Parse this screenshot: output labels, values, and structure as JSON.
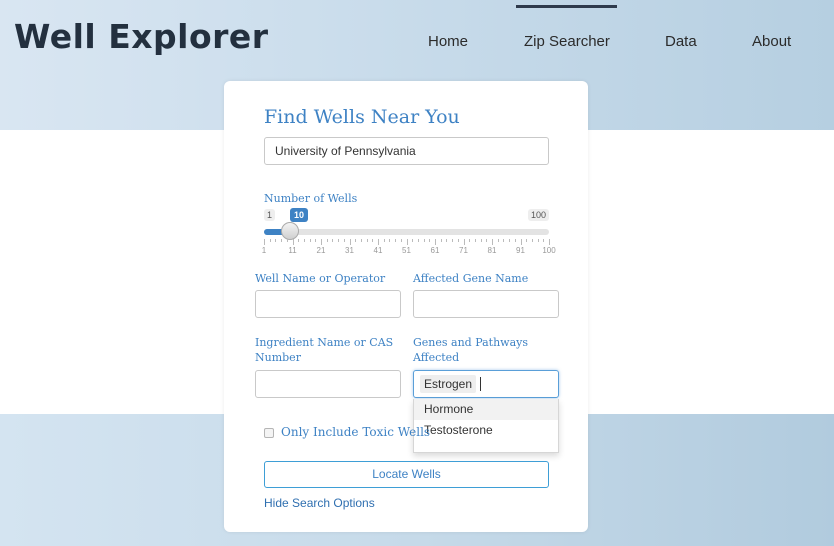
{
  "brand": "Well Explorer",
  "nav": {
    "home": "Home",
    "zip": "Zip Searcher",
    "data": "Data",
    "about": "About",
    "active": "Zip Searcher"
  },
  "form": {
    "title": "Find Wells Near You",
    "location_value": "University of Pennsylvania",
    "slider": {
      "label": "Number of Wells",
      "min": "1",
      "max": "100",
      "value": "10",
      "fraction": 0.09,
      "ticks": [
        "1",
        "11",
        "21",
        "31",
        "41",
        "51",
        "61",
        "71",
        "81",
        "91",
        "100"
      ]
    },
    "well_name_label": "Well Name or Operator",
    "well_name_value": "",
    "gene_name_label": "Affected Gene Name",
    "gene_name_value": "",
    "ingredient_label_1": "Ingredient Name or CAS",
    "ingredient_label_2": "Number",
    "ingredient_value": "",
    "pathways_label_1": "Genes and Pathways",
    "pathways_label_2": "Affected",
    "pathways_token": "Estrogen",
    "dropdown_options": [
      "Hormone",
      "Testosterone"
    ],
    "toxic_label": "Only Include Toxic Wells",
    "toxic_checked": false,
    "locate_button": "Locate Wells",
    "hide_link": "Hide Search Options"
  },
  "colors": {
    "accent": "#3e82c4",
    "brand_text": "#23303f",
    "nav_active_bar": "#2e3a4c"
  }
}
